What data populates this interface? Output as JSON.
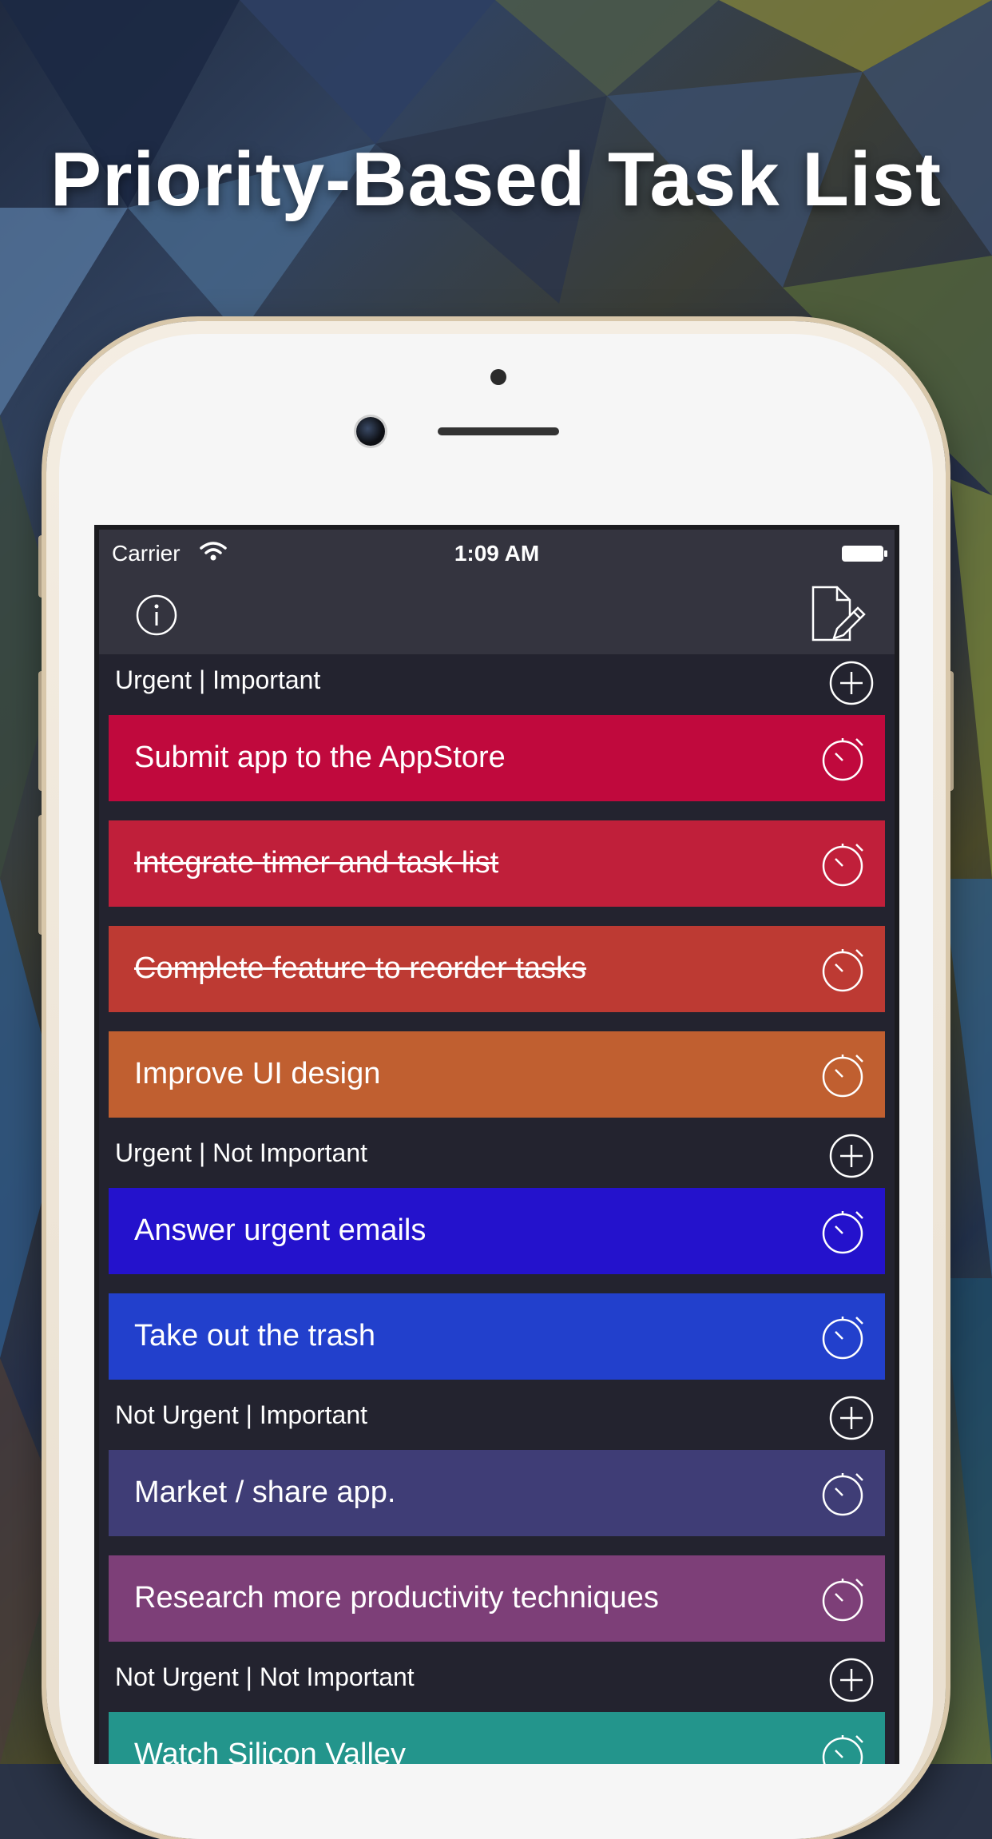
{
  "headline": "Priority-Based Task List",
  "status_bar": {
    "carrier": "Carrier",
    "time": "1:09 AM"
  },
  "icons": {
    "info": "info-icon",
    "compose": "compose-icon",
    "add": "add-circle-icon",
    "timer": "stopwatch-icon"
  },
  "sections": [
    {
      "title": "Urgent | Important",
      "tasks": [
        {
          "label": "Submit app to the AppStore",
          "done": false,
          "color": "#c0093d"
        },
        {
          "label": "Integrate timer and task list",
          "done": true,
          "color": "#c01f3a"
        },
        {
          "label": "Complete feature to reorder tasks",
          "done": true,
          "color": "#bd3a33"
        },
        {
          "label": "Improve UI design",
          "done": false,
          "color": "#c05f30"
        }
      ]
    },
    {
      "title": "Urgent | Not Important",
      "tasks": [
        {
          "label": "Answer urgent emails",
          "done": false,
          "color": "#2412cc"
        },
        {
          "label": "Take out the trash",
          "done": false,
          "color": "#2240cc"
        }
      ]
    },
    {
      "title": "Not Urgent | Important",
      "tasks": [
        {
          "label": "Market / share app.",
          "done": false,
          "color": "#3f3d76"
        },
        {
          "label": "Research more productivity techniques",
          "done": false,
          "color": "#7d3f78"
        }
      ]
    },
    {
      "title": "Not Urgent | Not Important",
      "tasks": [
        {
          "label": "Watch Silicon Valley",
          "done": false,
          "color": "#23958c"
        }
      ]
    }
  ]
}
